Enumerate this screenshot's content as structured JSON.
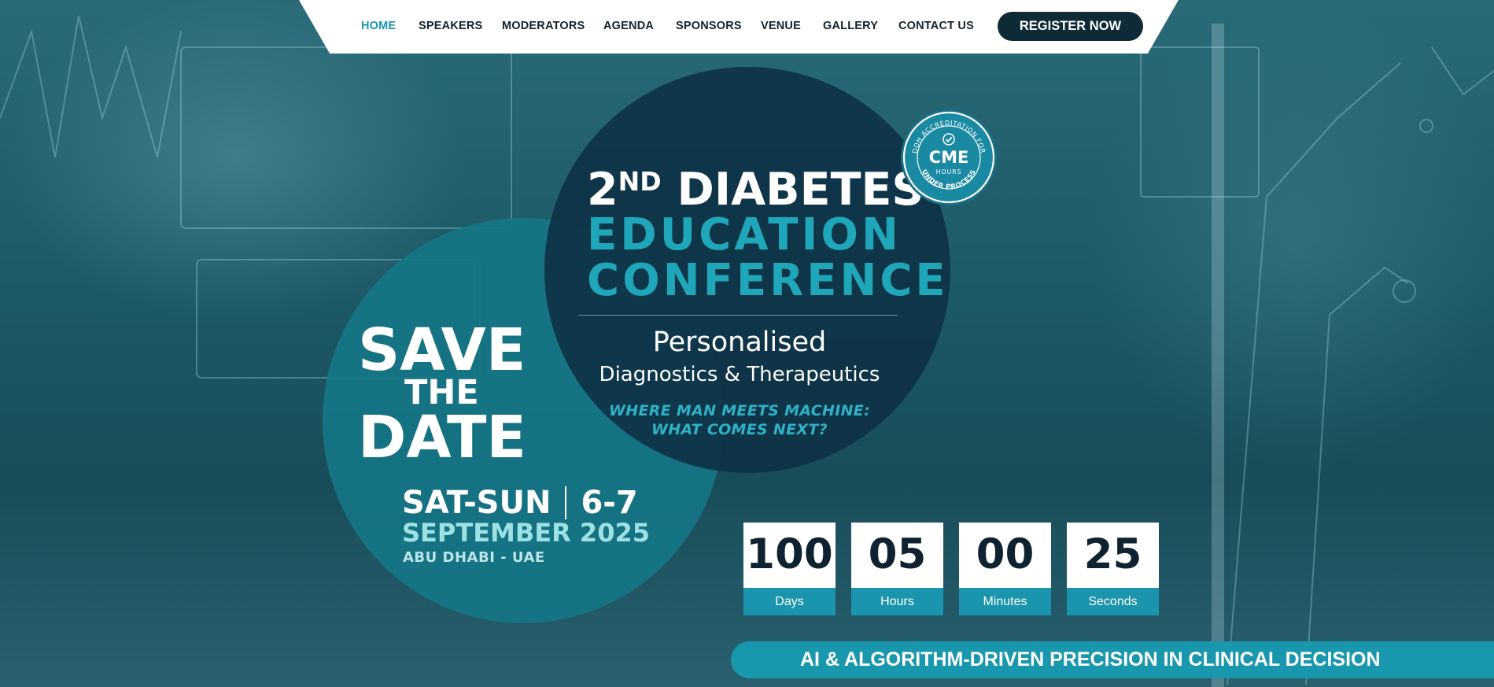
{
  "nav": {
    "items": [
      {
        "label": "HOME",
        "active": true
      },
      {
        "label": "SPEAKERS"
      },
      {
        "label": "MODERATORS"
      },
      {
        "label": "AGENDA"
      },
      {
        "label": "SPONSORS"
      },
      {
        "label": "VENUE"
      },
      {
        "label": "GALLERY"
      },
      {
        "label": "CONTACT US"
      }
    ],
    "register_label": "REGISTER NOW"
  },
  "hero": {
    "title_ordinal": "2",
    "title_ordinal_suffix": "ND",
    "title_word1": "DIABETES",
    "title_line2": "EDUCATION",
    "title_line3": "CONFERENCE",
    "subtitle1": "Personalised",
    "subtitle2": "Diagnostics & Therapeutics",
    "tagline1": "WHERE MAN MEETS MACHINE:",
    "tagline2": "WHAT COMES NEXT?",
    "save": "SAVE",
    "the": "THE",
    "date": "DATE",
    "days_of_week": "SAT-SUN",
    "day_range": "6-7",
    "month_year": "SEPTEMBER 2025",
    "city": "ABU DHABI - UAE"
  },
  "badge": {
    "top_text": "DOH ACCREDITATION FOR",
    "main": "CME",
    "sub": "HOURS",
    "bottom_text": "UNDER PROCESS",
    "icon": "check-icon"
  },
  "countdown": [
    {
      "value": "100",
      "label": "Days"
    },
    {
      "value": "05",
      "label": "Hours"
    },
    {
      "value": "00",
      "label": "Minutes"
    },
    {
      "value": "25",
      "label": "Seconds"
    }
  ],
  "banner": {
    "text": "AI & ALGORITHM-DRIVEN PRECISION IN CLINICAL DECISION"
  },
  "colors": {
    "accent": "#1a95ae",
    "navy": "#0d2a36",
    "dark_circle": "#0e3247",
    "teal_circle": "#157586"
  }
}
